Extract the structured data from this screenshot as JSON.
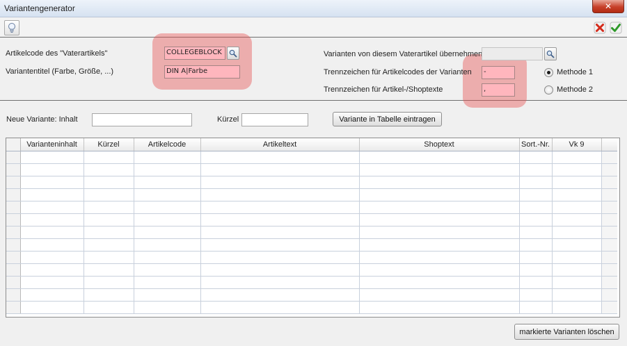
{
  "window": {
    "title": "Variantengenerator",
    "close_label": "✕"
  },
  "form": {
    "artikelcode_label": "Artikelcode des \"Vaterartikels\"",
    "artikelcode_value": "COLLEGEBLOCK",
    "variantentitel_label": "Variantentitel (Farbe, Größe, ...)",
    "variantentitel_value": "DIN A|Farbe",
    "uebernehmen_label": "Varianten von diesem Vaterartikel übernehmen",
    "uebernehmen_value": "",
    "trenn_codes_label": "Trennzeichen für Artikelcodes der Varianten",
    "trenn_codes_value": "-",
    "trenn_texte_label": "Trennzeichen für Artikel-/Shoptexte",
    "trenn_texte_value": ",",
    "methode1_label": "Methode 1",
    "methode2_label": "Methode 2",
    "selected_method": "Methode 1"
  },
  "neue_variante": {
    "inhalt_label": "Neue Variante: Inhalt",
    "inhalt_value": "",
    "kuerzel_label": "Kürzel",
    "kuerzel_value": "",
    "eintragen_button": "Variante in Tabelle eintragen"
  },
  "table": {
    "columns": [
      "Varianteninhalt",
      "Kürzel",
      "Artikelcode",
      "Artikeltext",
      "Shoptext",
      "Sort.-Nr.",
      "Vk 9"
    ],
    "rows": []
  },
  "footer": {
    "delete_button": "markierte Varianten löschen"
  },
  "colors": {
    "required_field": "#ffb6bd",
    "highlight": "#e65050"
  }
}
